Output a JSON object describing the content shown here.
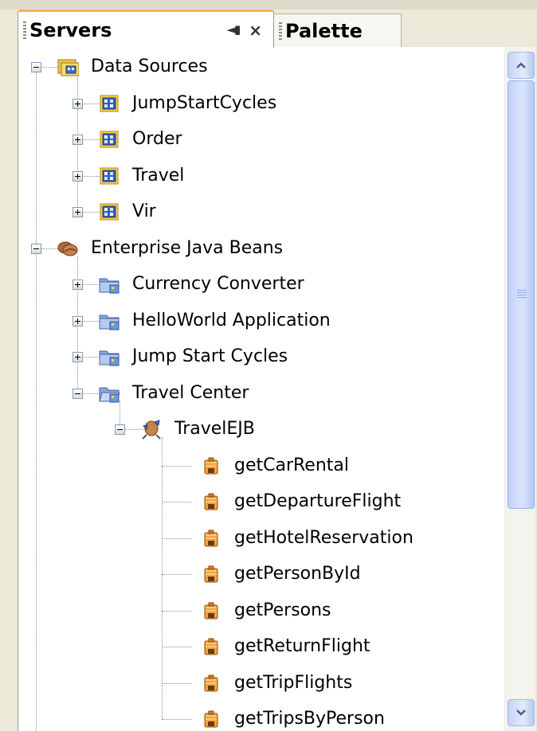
{
  "tabs": {
    "active": {
      "label": "Servers"
    },
    "inactive": {
      "label": "Palette"
    },
    "minimize_glyph": "◄▮",
    "close_glyph": "×"
  },
  "tree": {
    "data_sources": {
      "label": "Data Sources",
      "children": [
        "JumpStartCycles",
        "Order",
        "Travel",
        "Vir"
      ]
    },
    "ejb": {
      "label": "Enterprise Java Beans",
      "modules": [
        "Currency Converter",
        "HelloWorld Application",
        "Jump Start Cycles",
        "Travel Center"
      ],
      "bean": "TravelEJB",
      "methods": [
        "getCarRental",
        "getDepartureFlight",
        "getHotelReservation",
        "getPersonById",
        "getPersons",
        "getReturnFlight",
        "getTripFlights",
        "getTripsByPerson"
      ]
    }
  },
  "colors": {
    "tab_accent": "#f4b450",
    "scrollbar_thumb": "#c1d1fa",
    "selection_none": "#ffffff"
  }
}
